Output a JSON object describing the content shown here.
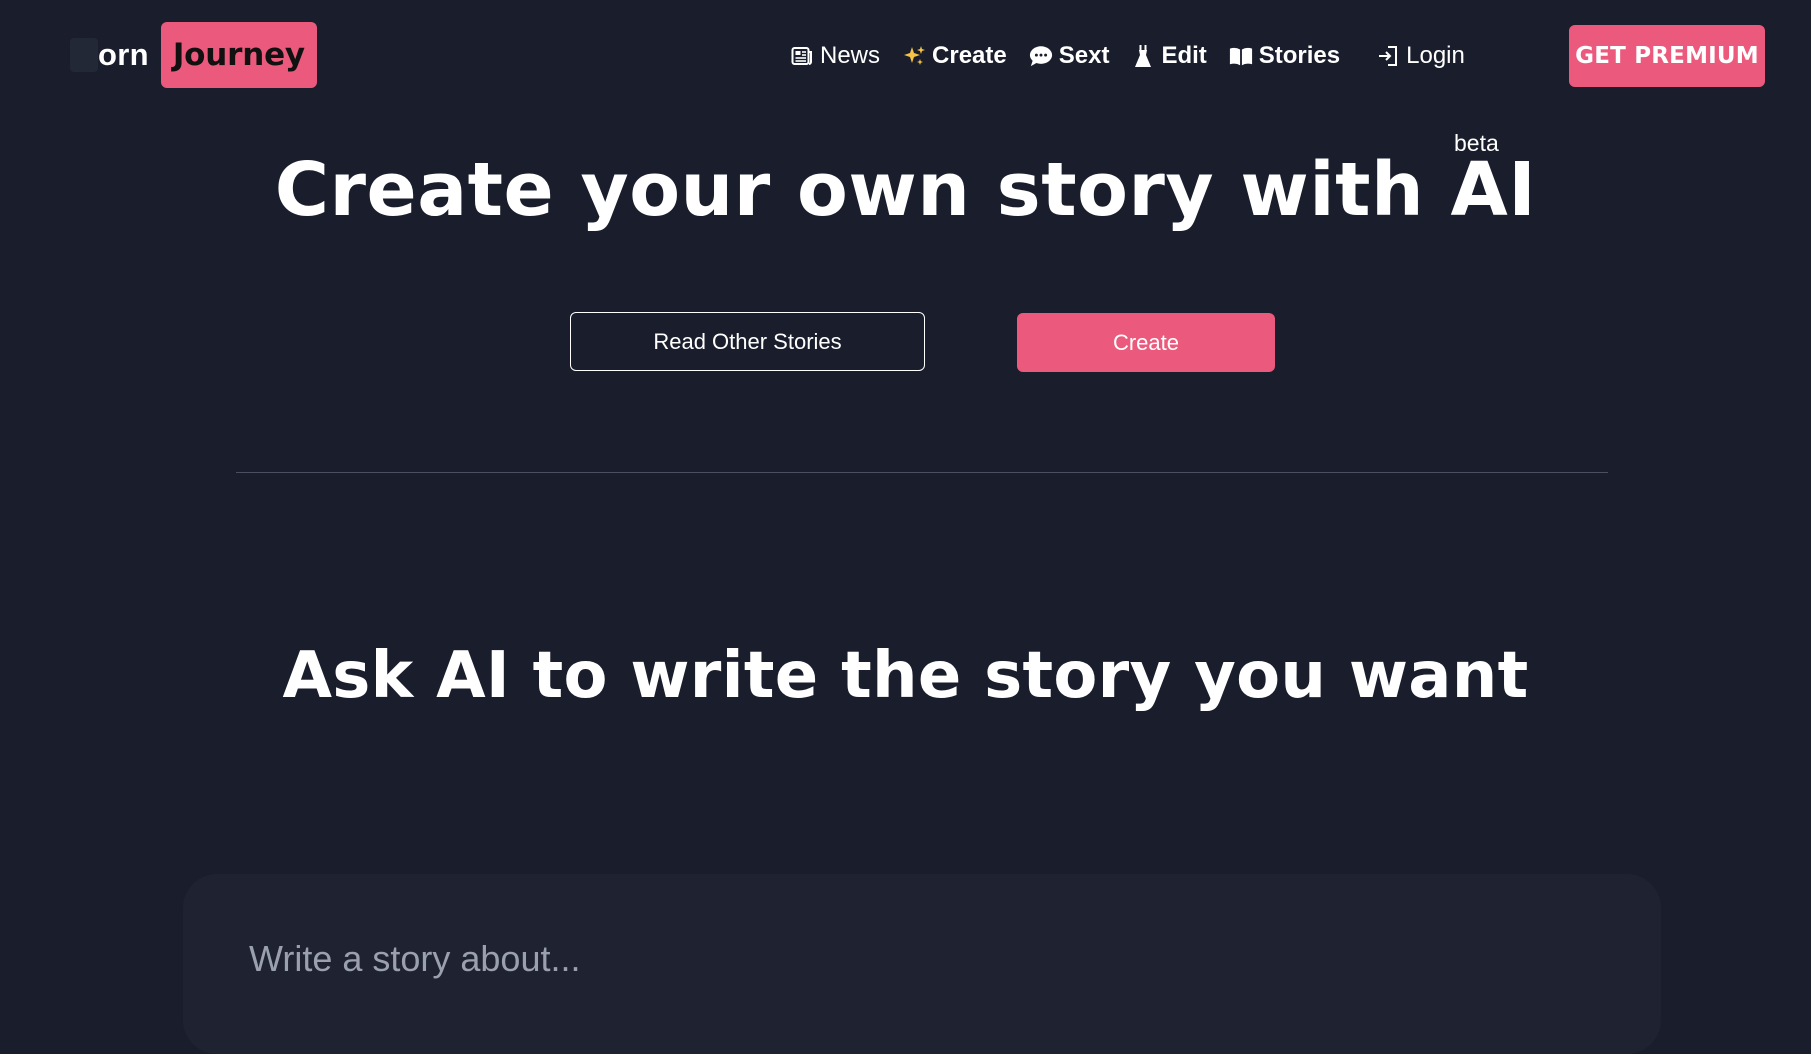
{
  "brand": {
    "name_first": "orn",
    "name_badge": "Journey"
  },
  "nav": {
    "items": [
      {
        "label": "News",
        "icon": "newspaper-icon"
      },
      {
        "label": "Create",
        "icon": "sparkles-icon"
      },
      {
        "label": "Sext",
        "icon": "speech-bubble-icon"
      },
      {
        "label": "Edit",
        "icon": "dress-icon"
      },
      {
        "label": "Stories",
        "icon": "open-book-icon"
      },
      {
        "label": "Login",
        "icon": "login-icon"
      }
    ],
    "premium_label": "GET PREMIUM"
  },
  "hero": {
    "title": "Create your own story with AI",
    "badge": "beta",
    "read_button": "Read Other Stories",
    "create_button": "Create"
  },
  "section": {
    "title": "Ask AI to write the story you want"
  },
  "prompt": {
    "placeholder": "Write a story about..."
  },
  "colors": {
    "background": "#1a1e2c",
    "accent": "#eb5a7c",
    "card": "#1e2231"
  }
}
